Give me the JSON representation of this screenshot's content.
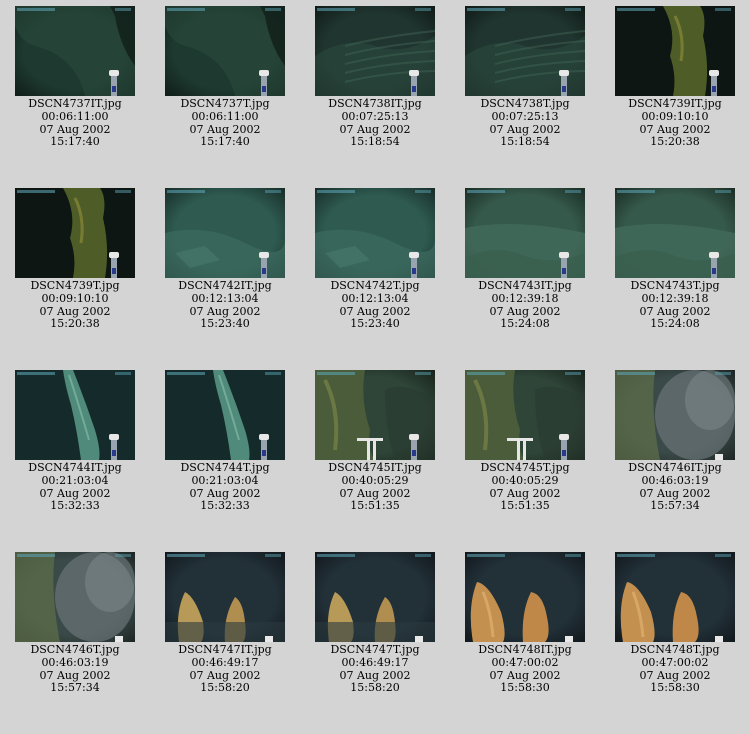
{
  "thumbnails": [
    {
      "file": "DSCN4737I T.jpg",
      "timecode": "00:06:11:00",
      "date": "07 Aug 2002",
      "time": "15:17:40",
      "scene": "dark-green-wall",
      "tint": "#1e3a30"
    },
    {
      "file": "DSCN4737T.jpg",
      "timecode": "00:06:11:00",
      "date": "07 Aug 2002",
      "time": "15:17:40",
      "scene": "dark-green-wall",
      "tint": "#1e3a30"
    },
    {
      "file": "DSCN4738I T.jpg",
      "timecode": "00:07:25:13",
      "date": "07 Aug 2002",
      "time": "15:18:54",
      "scene": "layered-rock",
      "tint": "#20352f"
    },
    {
      "file": "DSCN4738T.jpg",
      "timecode": "00:07:25:13",
      "date": "07 Aug 2002",
      "time": "15:18:54",
      "scene": "layered-rock",
      "tint": "#20352f"
    },
    {
      "file": "DSCN4739I T.jpg",
      "timecode": "00:09:10:10",
      "date": "07 Aug 2002",
      "time": "15:20:38",
      "scene": "yellow-chimney-dark",
      "tint": "#16261f"
    },
    {
      "file": "DSCN4739T.jpg",
      "timecode": "00:09:10:10",
      "date": "07 Aug 2002",
      "time": "15:20:38",
      "scene": "yellow-chimney-dark",
      "tint": "#16261f"
    },
    {
      "file": "DSCN4742I T.jpg",
      "timecode": "00:12:13:04",
      "date": "07 Aug 2002",
      "time": "15:23:40",
      "scene": "teal-seafloor",
      "tint": "#2e5a50"
    },
    {
      "file": "DSCN4742T.jpg",
      "timecode": "00:12:13:04",
      "date": "07 Aug 2002",
      "time": "15:23:40",
      "scene": "teal-seafloor",
      "tint": "#2e5a50"
    },
    {
      "file": "DSCN4743I T.jpg",
      "timecode": "00:12:39:18",
      "date": "07 Aug 2002",
      "time": "15:24:08",
      "scene": "green-seafloor",
      "tint": "#35594a"
    },
    {
      "file": "DSCN4743T.jpg",
      "timecode": "00:12:39:18",
      "date": "07 Aug 2002",
      "time": "15:24:08",
      "scene": "green-seafloor",
      "tint": "#35594a"
    },
    {
      "file": "DSCN4744I T.jpg",
      "timecode": "00:21:03:04",
      "date": "07 Aug 2002",
      "time": "15:32:33",
      "scene": "teal-spire",
      "tint": "#1f3d3b"
    },
    {
      "file": "DSCN4744T.jpg",
      "timecode": "00:21:03:04",
      "date": "07 Aug 2002",
      "time": "15:32:33",
      "scene": "teal-spire",
      "tint": "#1f3d3b"
    },
    {
      "file": "DSCN4745I T.jpg",
      "timecode": "00:40:05:29",
      "date": "07 Aug 2002",
      "time": "15:51:35",
      "scene": "olive-chimney",
      "tint": "#2f4538"
    },
    {
      "file": "DSCN4745T.jpg",
      "timecode": "00:40:05:29",
      "date": "07 Aug 2002",
      "time": "15:51:35",
      "scene": "olive-chimney",
      "tint": "#2f4538"
    },
    {
      "file": "DSCN4746I T.jpg",
      "timecode": "00:46:03:19",
      "date": "07 Aug 2002",
      "time": "15:57:34",
      "scene": "smoky-chimney",
      "tint": "#3a4a48"
    },
    {
      "file": "DSCN4746T.jpg",
      "timecode": "00:46:03:19",
      "date": "07 Aug 2002",
      "time": "15:57:34",
      "scene": "smoky-chimney",
      "tint": "#3a4a48"
    },
    {
      "file": "DSCN4747I T.jpg",
      "timecode": "00:46:49:17",
      "date": "07 Aug 2002",
      "time": "15:58:20",
      "scene": "twin-spires",
      "tint": "#223038"
    },
    {
      "file": "DSCN4747T.jpg",
      "timecode": "00:46:49:17",
      "date": "07 Aug 2002",
      "time": "15:58:20",
      "scene": "twin-spires",
      "tint": "#223038"
    },
    {
      "file": "DSCN4748I T.jpg",
      "timecode": "00:47:00:02",
      "date": "07 Aug 2002",
      "time": "15:58:30",
      "scene": "orange-spires",
      "tint": "#223038"
    },
    {
      "file": "DSCN4748T.jpg",
      "timecode": "00:47:00:02",
      "date": "07 Aug 2002",
      "time": "15:58:30",
      "scene": "orange-spires",
      "tint": "#223038"
    }
  ]
}
